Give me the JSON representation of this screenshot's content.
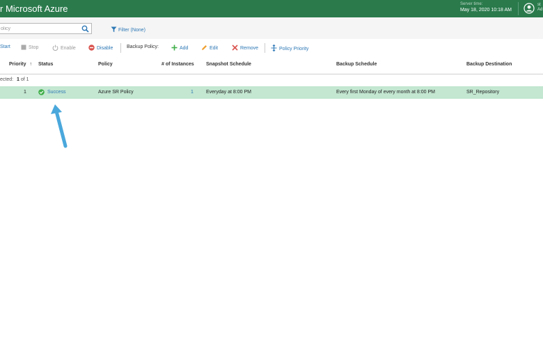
{
  "header": {
    "app_title": "r Microsoft Azure",
    "server_time_label": "Server time:",
    "server_time": "May 18, 2020 10:18 AM",
    "user_line1": "st",
    "user_line2": "Ad"
  },
  "search": {
    "value": "olicy",
    "filter_label": "Filter (None)"
  },
  "toolbar": {
    "start": "Start",
    "stop": "Stop",
    "enable": "Enable",
    "disable": "Disable",
    "backup_policy_label": "Backup Policy:",
    "add": "Add",
    "edit": "Edit",
    "remove": "Remove",
    "policy_priority": "Policy Priority"
  },
  "columns": {
    "priority": "Priority",
    "sort_arrow": "↑",
    "status": "Status",
    "policy": "Policy",
    "instances": "# of Instances",
    "snapshot_schedule": "Snapshot Schedule",
    "backup_schedule": "Backup Schedule",
    "backup_destination": "Backup Destination"
  },
  "selection": {
    "label": "ected:",
    "count": "1",
    "of_total": "of 1"
  },
  "rows": [
    {
      "priority": "1",
      "status": "Success",
      "policy": "Azure SR Policy",
      "instances": "1",
      "snapshot_schedule": "Everyday at 8:00 PM",
      "backup_schedule": "Every first Monday of every month at 8:00 PM",
      "backup_destination": "SR_Repository"
    }
  ],
  "colors": {
    "header_bg": "#2a7a4c",
    "selected_row": "#c3e7d1",
    "link": "#2c77b5",
    "success": "#3fae49",
    "danger": "#d9534f",
    "arrow": "#4aa8dc"
  },
  "icons": {
    "search": "search-icon",
    "filter": "filter-icon",
    "start": "play-icon",
    "stop": "stop-icon",
    "enable": "power-icon",
    "disable": "disable-icon",
    "add": "plus-icon",
    "edit": "pencil-icon",
    "remove": "x-icon",
    "policy_priority": "priority-icon",
    "status": "check-circle-icon",
    "user": "user-icon"
  }
}
